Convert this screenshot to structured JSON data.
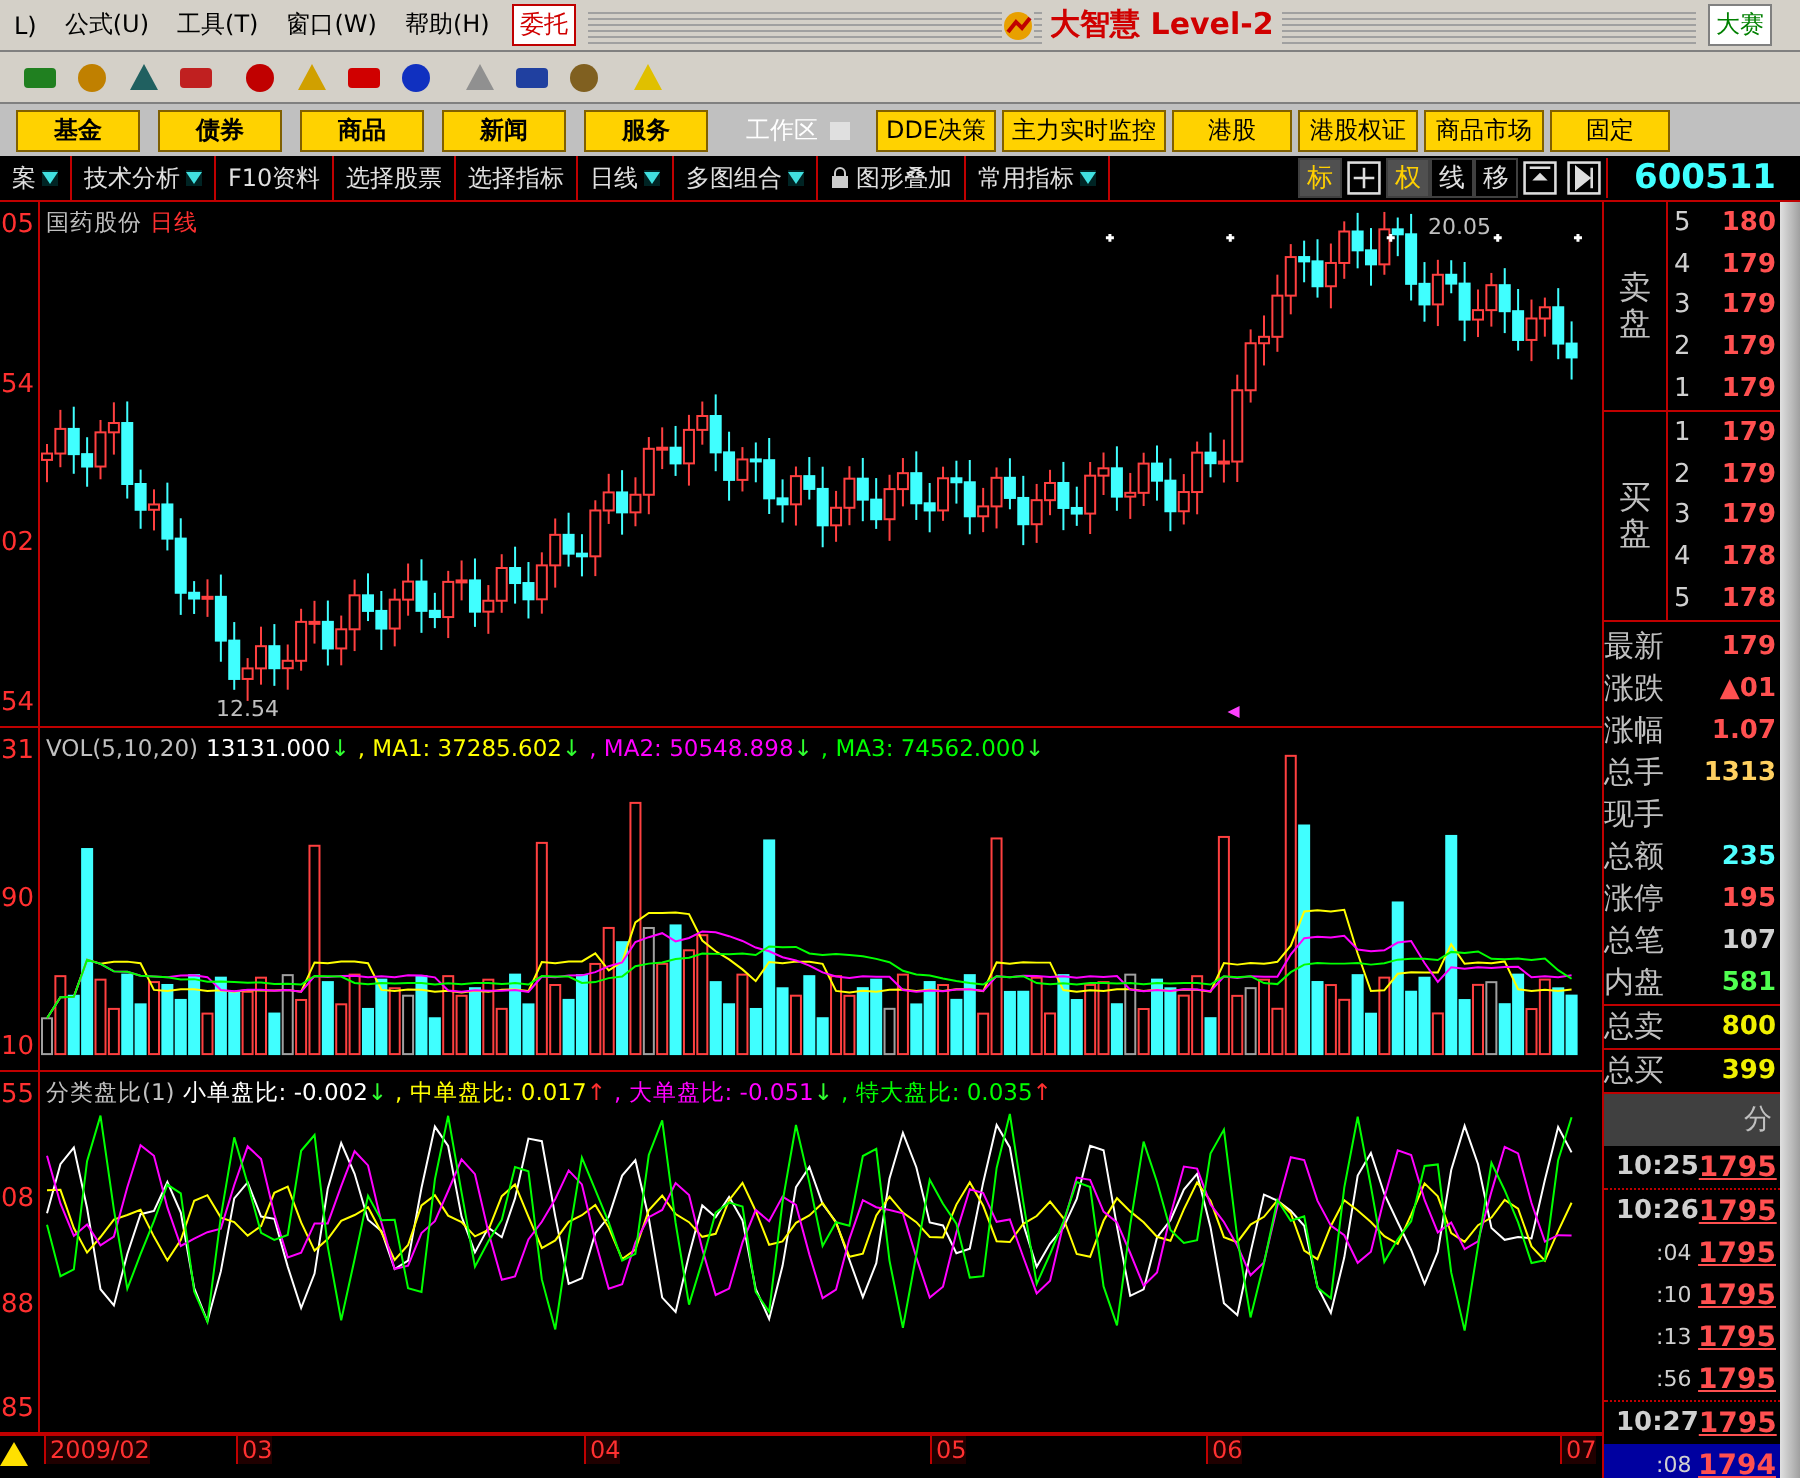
{
  "menu": [
    "L)",
    "公式(U)",
    "工具(T)",
    "窗口(W)",
    "帮助(H)"
  ],
  "menu_button": "委托",
  "app_title": "大智慧 Level-2",
  "contest_button": "大赛",
  "nav_buttons": [
    {
      "label": "基金",
      "kind": "main"
    },
    {
      "label": "债券",
      "kind": "main"
    },
    {
      "label": "商品",
      "kind": "main"
    },
    {
      "label": "新闻",
      "kind": "main"
    },
    {
      "label": "服务",
      "kind": "main"
    },
    {
      "label": "工作区",
      "kind": "workspace"
    },
    {
      "label": "DDE决策",
      "kind": "link"
    },
    {
      "label": "主力实时监控",
      "kind": "link"
    },
    {
      "label": "港股",
      "kind": "link"
    },
    {
      "label": "港股权证",
      "kind": "link"
    },
    {
      "label": "商品市场",
      "kind": "link"
    },
    {
      "label": "固定",
      "kind": "link"
    }
  ],
  "function_tabs": [
    {
      "label": "案",
      "dropdown": true
    },
    {
      "label": "技术分析",
      "dropdown": true
    },
    {
      "label": "F10资料",
      "dropdown": false
    },
    {
      "label": "选择股票",
      "dropdown": false
    },
    {
      "label": "选择指标",
      "dropdown": false
    },
    {
      "label": "日线",
      "dropdown": true
    },
    {
      "label": "多图组合",
      "dropdown": true
    },
    {
      "label": "图形叠加",
      "dropdown": false,
      "lock": true
    },
    {
      "label": "常用指标",
      "dropdown": true
    }
  ],
  "chart_tools": [
    {
      "kind": "text",
      "label": "标",
      "selected": true
    },
    {
      "kind": "grid"
    },
    {
      "kind": "text",
      "label": "权",
      "selected": true
    },
    {
      "kind": "text",
      "label": "线",
      "selected": false
    },
    {
      "kind": "text",
      "label": "移",
      "selected": false
    },
    {
      "kind": "restore"
    },
    {
      "kind": "play"
    }
  ],
  "stock_code": "600511",
  "price_panel": {
    "name": "国药股份",
    "period": "日线",
    "high_label": "20.05",
    "low_label": "12.54",
    "axis": [
      "05",
      "54",
      "02",
      "54"
    ]
  },
  "volume_panel": {
    "title": "VOL(5,10,20)",
    "axis": [
      "31",
      "90",
      "10"
    ],
    "legend": [
      {
        "text": "13131.000",
        "up": false,
        "arrow": "↓",
        "color": "#ffffff"
      },
      {
        "text": ", MA1: 37285.602",
        "up": false,
        "arrow": "↓",
        "color": "#ffff00"
      },
      {
        "text": ", MA2: 50548.898",
        "up": false,
        "arrow": "↓",
        "color": "#ff00ff"
      },
      {
        "text": ", MA3: 74562.000",
        "up": false,
        "arrow": "↓",
        "color": "#00ff00"
      }
    ]
  },
  "ratio_panel": {
    "title": "分类盘比(1)",
    "axis": [
      "55",
      "08",
      "88",
      "85"
    ],
    "legend": [
      {
        "text": "小单盘比: -0.002",
        "up": false,
        "arrow": "↓",
        "color": "#ffffff"
      },
      {
        "text": ", 中单盘比: 0.017",
        "up": true,
        "arrow": "↑",
        "color": "#ffff00"
      },
      {
        "text": ", 大单盘比: -0.051",
        "up": false,
        "arrow": "↓",
        "color": "#ff00ff"
      },
      {
        "text": ", 特大盘比: 0.035",
        "up": true,
        "arrow": "↑",
        "color": "#00ff00"
      }
    ]
  },
  "date_axis": [
    "2009/02",
    "03",
    "04",
    "05",
    "06",
    "07"
  ],
  "sell_book": {
    "label": "卖盘",
    "rows": [
      {
        "level": "5",
        "price": "180"
      },
      {
        "level": "4",
        "price": "179"
      },
      {
        "level": "3",
        "price": "179"
      },
      {
        "level": "2",
        "price": "179"
      },
      {
        "level": "1",
        "price": "179"
      }
    ]
  },
  "buy_book": {
    "label": "买盘",
    "rows": [
      {
        "level": "1",
        "price": "179"
      },
      {
        "level": "2",
        "price": "179"
      },
      {
        "level": "3",
        "price": "179"
      },
      {
        "level": "4",
        "price": "178"
      },
      {
        "level": "5",
        "price": "178"
      }
    ]
  },
  "stats": [
    {
      "label": "最新",
      "value": "179",
      "color": "#ff5050"
    },
    {
      "label": "涨跌",
      "value": "▲01",
      "color": "#ff5050"
    },
    {
      "label": "涨幅",
      "value": "1.07",
      "color": "#ff5050"
    },
    {
      "label": "总手",
      "value": "1313",
      "color": "#ffd060"
    },
    {
      "label": "现手"
    },
    {
      "label": "总额",
      "value": "235",
      "color": "#50ffff"
    },
    {
      "label": "涨停",
      "value": "195",
      "color": "#ff5050"
    },
    {
      "label": "总笔",
      "value": "107",
      "color": "#d0d0d0"
    },
    {
      "label": "内盘",
      "value": "581",
      "color": "#50ff50"
    }
  ],
  "totals": [
    {
      "label": "总卖",
      "value": "800"
    },
    {
      "label": "总买",
      "value": "399"
    }
  ],
  "ticks_header": "分",
  "ticks": [
    {
      "time": "10:25",
      "price": "1795",
      "kind": "minute",
      "selected": false
    },
    {
      "time": "10:26",
      "price": "1795",
      "kind": "minute",
      "selected": false
    },
    {
      "time": ":04",
      "price": "1795",
      "kind": "second",
      "selected": false
    },
    {
      "time": ":10",
      "price": "1795",
      "kind": "second",
      "selected": false
    },
    {
      "time": ":13",
      "price": "1795",
      "kind": "second",
      "selected": false
    },
    {
      "time": ":56",
      "price": "1795",
      "kind": "second",
      "selected": false
    },
    {
      "time": "10:27",
      "price": "1795",
      "kind": "minute",
      "selected": false
    },
    {
      "time": ":08",
      "price": "1794",
      "kind": "second",
      "selected": true
    }
  ]
}
